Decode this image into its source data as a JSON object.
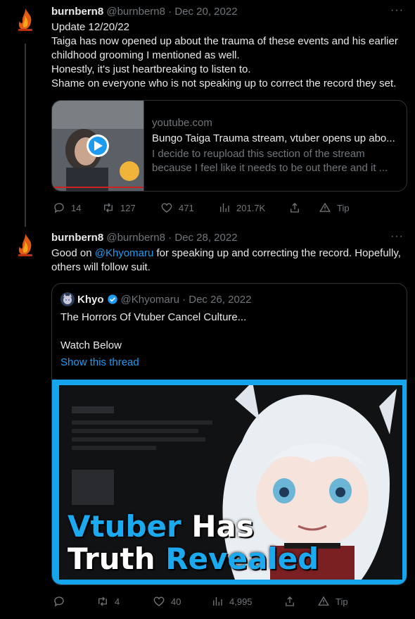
{
  "tweet1": {
    "name": "burnbern8",
    "handle": "@burnbern8",
    "date": "· Dec 20, 2022",
    "lines": [
      "Update 12/20/22",
      "Taiga has now opened up about the trauma of these events and his earlier childhood grooming I mentioned as well.",
      "Honestly, it's just heartbreaking to listen to.",
      "Shame on everyone who is not speaking up to correct the record they set."
    ],
    "card": {
      "domain": "youtube.com",
      "title": "Bungo Taiga Trauma stream, vtuber opens up abo...",
      "description_1": "I decide to reupload this section of the stream",
      "description_2": "because I feel like it needs to be out there and it ..."
    },
    "stats": {
      "replies": "14",
      "retweets": "127",
      "likes": "471",
      "views": "201.7K",
      "tip": "Tip"
    }
  },
  "tweet2": {
    "name": "burnbern8",
    "handle": "@burnbern8",
    "date": "· Dec 28, 2022",
    "text_before": "Good on ",
    "mention": "@Khyomaru",
    "text_after": " for speaking up and correcting the record. Hopefully, others will follow suit.",
    "quote": {
      "name": "Khyo",
      "handle": "@Khyomaru",
      "date": "· Dec 26, 2022",
      "line1": "The Horrors Of Vtuber Cancel Culture...",
      "line2": "Watch Below",
      "show_thread": "Show this thread",
      "thumb_word1": "Vtuber",
      "thumb_word2": "Has",
      "thumb_word3": "Truth",
      "thumb_word4": "Revealed"
    },
    "stats": {
      "replies": "",
      "retweets": "4",
      "likes": "40",
      "views": "4,995",
      "tip": "Tip"
    }
  },
  "colors": {
    "accent": "#1d9bf0",
    "muted": "#71767b",
    "thumb_blue": "#15a5ec"
  }
}
